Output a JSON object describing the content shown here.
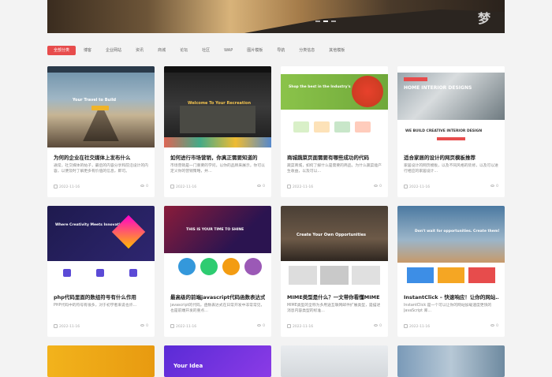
{
  "hero": {
    "mark": "梦"
  },
  "filters": [
    {
      "label": "全部分类",
      "active": true
    },
    {
      "label": "博客"
    },
    {
      "label": "企业网站"
    },
    {
      "label": "资讯"
    },
    {
      "label": "商城"
    },
    {
      "label": "论坛"
    },
    {
      "label": "社区"
    },
    {
      "label": "WAP"
    },
    {
      "label": "图片模板"
    },
    {
      "label": "导航"
    },
    {
      "label": "分类信息"
    },
    {
      "label": "其他模板"
    }
  ],
  "cards": [
    {
      "title": "为何的企业在社交媒体上发布什么",
      "desc": "通常，社交媒体的帖子，最后的内容分享和前沿设计的内容，以便及时了解更多有价值的信息，即可。",
      "date": "2022-11-16",
      "views": "0",
      "thumb": {
        "headline": "Your Travel to Build",
        "btn": "Learn More"
      }
    },
    {
      "title": "如何进行市场营销，你真正需要知道的",
      "desc": "市场营销是一门重要的学问，以你的品牌来展示，你可以定义你的营销策略，并…",
      "date": "2022-11-16",
      "views": "0",
      "thumb": {
        "headline": "Welcome To Your Recreation",
        "btn": ""
      }
    },
    {
      "title": "商城蔬菜页面需要有哪些成功的代码",
      "desc": "蔬菜商城，如何了解什么是需要的商品，为什么蔬菜能产生收益，以及可以…",
      "date": "2022-11-16",
      "views": "0",
      "thumb": {
        "headline": "Shop the best in the Industry's",
        "btn": "Shop Now"
      }
    },
    {
      "title": "适合家居的设计的网页模板推荐",
      "desc": "家居设计的网页模板，以及不同风格的装修，以及可以进行相应的家居设计…",
      "date": "2022-11-16",
      "views": "0",
      "thumb": {
        "headline": "HOME INTERIOR DESIGNS",
        "btn": "WE BUILD CREATIVE INTERIOR DESIGN"
      }
    },
    {
      "title": "php代码里面的数组符号有什么作用",
      "desc": "PHP代码中的符号有很多，对于初学者来说也许…",
      "date": "2022-11-16",
      "views": "0",
      "thumb": {
        "headline": "Where Creativity Meets Innovation",
        "btn": ""
      }
    },
    {
      "title": "最高级的前端javascript代码函数表达式",
      "desc": "javascript的代码，函数表达式在日常开发中非常常见，也是前端开发的重点…",
      "date": "2022-11-16",
      "views": "0",
      "thumb": {
        "headline": "THIS IS YOUR TIME TO SHINE",
        "btn": ""
      }
    },
    {
      "title": "MIME类型是什么？一文带你看懂MIME",
      "desc": "MIME类型的全称为多用途互联网邮件扩展类型，是描述消息内容类型的标准…",
      "date": "2022-11-16",
      "views": "0",
      "thumb": {
        "headline": "Create Your Own Opportunities",
        "btn": ""
      }
    },
    {
      "title": "InstantClick – 快速响应！让你的网站…",
      "desc": "InstantClick 是一个可以让你的网站加载速度更快的 JavaScript 库…",
      "date": "2022-11-16",
      "views": "0",
      "thumb": {
        "headline": "Don't wait for opportunities. Create them!",
        "btn": ""
      }
    }
  ],
  "partials": [
    {
      "headline": ""
    },
    {
      "headline": "Your Idea"
    },
    {
      "headline": ""
    },
    {
      "headline": ""
    }
  ],
  "colors": {
    "accent": "#e74c4c"
  }
}
